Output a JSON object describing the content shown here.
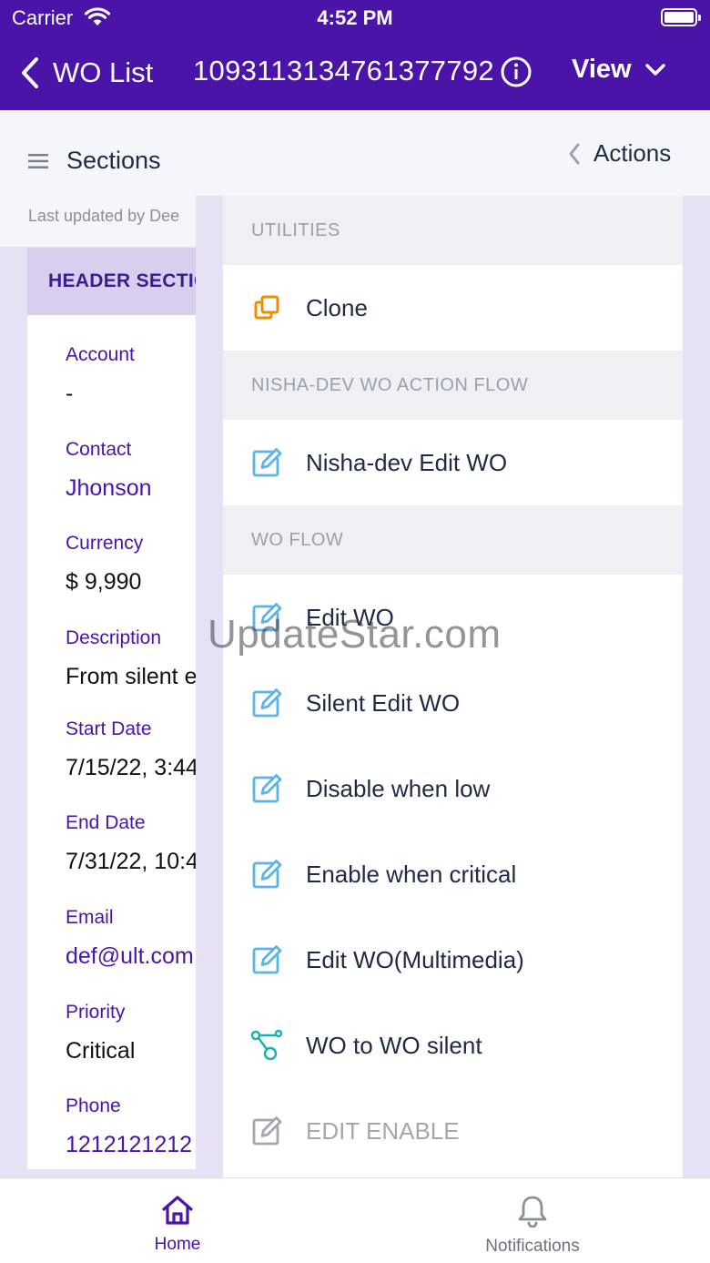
{
  "status_bar": {
    "carrier": "Carrier",
    "time": "4:52 PM"
  },
  "nav": {
    "back_label": "WO List",
    "record_id": "1093113134761377792",
    "view_label": "View"
  },
  "sections": {
    "title": "Sections",
    "last_updated": "Last updated by Dee",
    "actions_label": "Actions"
  },
  "detail": {
    "header": "HEADER SECTION",
    "fields": [
      {
        "label": "Account",
        "value": "-"
      },
      {
        "label": "Contact",
        "value": "Jhonson"
      },
      {
        "label": "Currency",
        "value": "$ 9,990"
      },
      {
        "label": "Description",
        "value": "From silent e"
      },
      {
        "label": "Start Date",
        "value": "7/15/22, 3:44"
      },
      {
        "label": "End Date",
        "value": "7/31/22, 10:4"
      },
      {
        "label": "Email",
        "value": "def@ult.com"
      },
      {
        "label": "Priority",
        "value": "Critical"
      },
      {
        "label": "Phone",
        "value": "1212121212"
      }
    ]
  },
  "actions_panel": {
    "groups": [
      {
        "title": "UTILITIES",
        "items": [
          {
            "label": "Clone",
            "icon": "clone-icon"
          }
        ]
      },
      {
        "title": "NISHA-DEV WO ACTION FLOW",
        "items": [
          {
            "label": "Nisha-dev Edit WO",
            "icon": "edit-icon"
          }
        ]
      },
      {
        "title": "WO FLOW",
        "items": [
          {
            "label": "Edit WO",
            "icon": "edit-icon"
          },
          {
            "label": "Silent Edit WO",
            "icon": "edit-icon"
          },
          {
            "label": "Disable when low",
            "icon": "edit-icon"
          },
          {
            "label": "Enable when critical",
            "icon": "edit-icon"
          },
          {
            "label": "Edit WO(Multimedia)",
            "icon": "edit-icon"
          },
          {
            "label": "WO to WO silent",
            "icon": "flow-icon"
          },
          {
            "label": "EDIT ENABLE",
            "icon": "edit-icon-disabled"
          }
        ]
      }
    ]
  },
  "watermark": "UpdateStar.com",
  "tabbar": {
    "home_label": "Home",
    "notifications_label": "Notifications"
  },
  "colors": {
    "brand": "#4a14a8",
    "accent_orange": "#f08c00",
    "edit_blue": "#5bb4e8",
    "flow_teal": "#17b3b3"
  }
}
